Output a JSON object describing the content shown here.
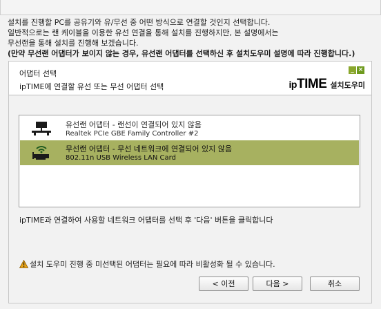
{
  "intro": {
    "line1": "설치를 진행할 PC를 공유기와 유/무선 중 어떤 방식으로 연결할 것인지 선택합니다.",
    "line2": "일반적으로는 랜 케이블을 이용한 유선 연결을 통해 설치를 진행하지만, 본 설명에서는",
    "line3": "무선랜을 통해 설치를 진행해 보겠습니다.",
    "line4": "(만약 무선랜 어댑터가 보이지 않는 경우, 유선랜 어댑터를 선택하신 후 설치도우미 설명에 따라 진행합니다.)"
  },
  "header": {
    "title": "어댑터 선택",
    "subtitle": "ipTIME에 연결할 유선 또는 무선 어댑터 선택",
    "brand_ip": "ip",
    "brand_time": "TIME",
    "brand_sub": "설치도우미",
    "minimize_glyph": "_",
    "close_glyph": "×"
  },
  "adapters": [
    {
      "name": "유선랜 어댑터 - 랜선이 연결되어 있지 않음",
      "description": "Realtek PCIe GBE Family Controller #2",
      "icon": "wired-network-icon",
      "selected": false
    },
    {
      "name": "무선랜 어댑터 - 무선 네트워크에 연결되어 있지 않음",
      "description": "802.11n USB Wireless LAN Card",
      "icon": "wireless-card-icon",
      "selected": true
    }
  ],
  "instruction": "ipTIME과 연결하여 사용할 네트워크 어댑터를 선택 후 '다음' 버튼을 클릭합니다",
  "warning": "설치 도우미 진행 중 미선택된 어댑터는 필요에 따라 비활성화 될 수 있습니다.",
  "buttons": {
    "prev": "< 이전",
    "next": "다음 >",
    "cancel": "취소"
  },
  "colors": {
    "selected_row": "#a7b160",
    "window_controls": "#8aa72d",
    "warning_icon": "#e8a317"
  }
}
